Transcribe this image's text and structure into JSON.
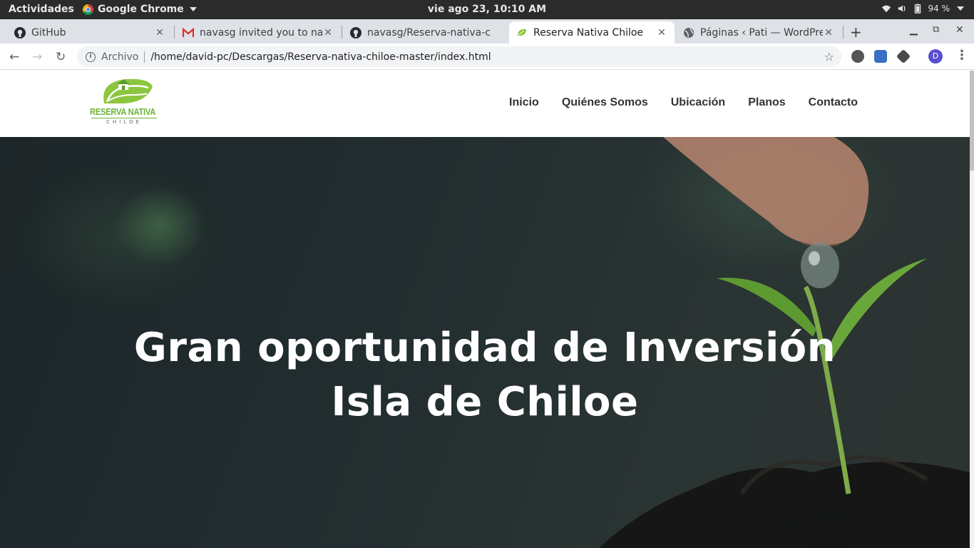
{
  "system": {
    "activities": "Actividades",
    "app_name": "Google Chrome",
    "clock": "vie ago 23, 10:10 AM",
    "battery": "94 %"
  },
  "tabs": [
    {
      "title": "GitHub",
      "icon": "github-icon"
    },
    {
      "title": "navasg invited you to navasg/Reserva-nativa-chiloe",
      "icon": "gmail-icon"
    },
    {
      "title": "navasg/Reserva-nativa-chiloe",
      "icon": "github-icon"
    },
    {
      "title": "Reserva Nativa Chiloe",
      "icon": "leaf-icon",
      "active": true
    },
    {
      "title": "Páginas ‹ Pati — WordPress",
      "icon": "globe-icon"
    }
  ],
  "address_bar": {
    "chip": "Archivo",
    "url": "/home/david-pc/Descargas/Reserva-nativa-chiloe-master/index.html"
  },
  "profile": {
    "initial": "D"
  },
  "site": {
    "logo": {
      "brand": "RESERVA NATIVA",
      "sub": "CHILOE"
    },
    "menu": [
      "Inicio",
      "Quiénes Somos",
      "Ubicación",
      "Planos",
      "Contacto"
    ],
    "hero_title": "Gran oportunidad de Inversión Isla de Chiloe"
  },
  "colors": {
    "brand_green": "#6bb43a",
    "hero_overlay": "#222d2f",
    "topbar": "#2b2b2b"
  }
}
